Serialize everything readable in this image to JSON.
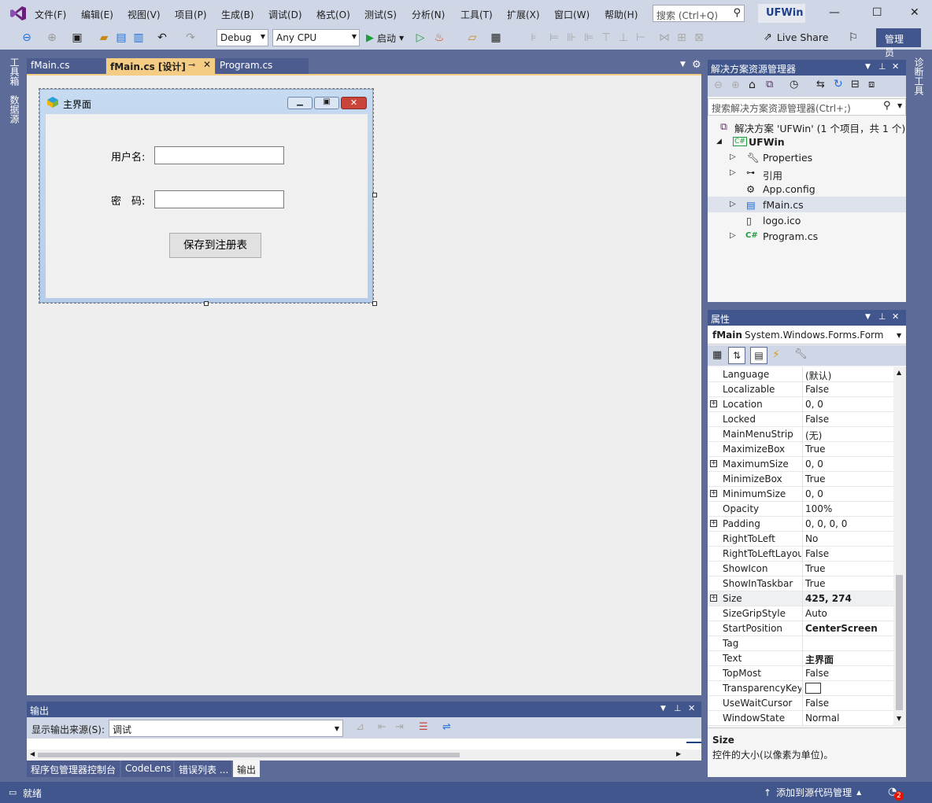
{
  "titlebar": {
    "menu": [
      "文件(F)",
      "编辑(E)",
      "视图(V)",
      "项目(P)",
      "生成(B)",
      "调试(D)",
      "格式(O)",
      "测试(S)",
      "分析(N)",
      "工具(T)",
      "扩展(X)",
      "窗口(W)",
      "帮助(H)"
    ],
    "search_placeholder": "搜索 (Ctrl+Q)",
    "solution_name": "UFWin",
    "minimize": "—",
    "maximize": "☐",
    "close": "✕"
  },
  "toolbar": {
    "config": "Debug",
    "platform": "Any CPU",
    "start_label": "启动",
    "live_share": "Live Share",
    "admin_label": "管理员"
  },
  "left_strip": {
    "toolbox": "工具箱",
    "datasource": "数据源"
  },
  "right_strip": {
    "diagnostics": "诊断工具"
  },
  "doc_tabs": [
    {
      "label": "fMain.cs"
    },
    {
      "label": "fMain.cs [设计]"
    },
    {
      "label": "Program.cs"
    }
  ],
  "form": {
    "title": "主界面",
    "username_label": "用户名:",
    "password_label": "密　码:",
    "save_button": "保存到注册表"
  },
  "solution_explorer": {
    "title": "解决方案资源管理器",
    "search_placeholder": "搜索解决方案资源管理器(Ctrl+;)",
    "items": [
      {
        "label": "解决方案 'UFWin' (1 个项目，共 1 个)"
      },
      {
        "label": "UFWin"
      },
      {
        "label": "Properties"
      },
      {
        "label": "引用"
      },
      {
        "label": "App.config"
      },
      {
        "label": "fMain.cs"
      },
      {
        "label": "logo.ico"
      },
      {
        "label": "Program.cs"
      }
    ]
  },
  "properties": {
    "title": "属性",
    "object_name": "fMain",
    "object_type": "System.Windows.Forms.Form",
    "rows": [
      {
        "name": "Language",
        "value": "(默认)"
      },
      {
        "name": "Localizable",
        "value": "False"
      },
      {
        "name": "Location",
        "value": "0, 0"
      },
      {
        "name": "Locked",
        "value": "False"
      },
      {
        "name": "MainMenuStrip",
        "value": "(无)"
      },
      {
        "name": "MaximizeBox",
        "value": "True"
      },
      {
        "name": "MaximumSize",
        "value": "0, 0"
      },
      {
        "name": "MinimizeBox",
        "value": "True"
      },
      {
        "name": "MinimumSize",
        "value": "0, 0"
      },
      {
        "name": "Opacity",
        "value": "100%"
      },
      {
        "name": "Padding",
        "value": "0, 0, 0, 0"
      },
      {
        "name": "RightToLeft",
        "value": "No"
      },
      {
        "name": "RightToLeftLayout",
        "value": "False"
      },
      {
        "name": "ShowIcon",
        "value": "True"
      },
      {
        "name": "ShowInTaskbar",
        "value": "True"
      },
      {
        "name": "Size",
        "value": "425, 274"
      },
      {
        "name": "SizeGripStyle",
        "value": "Auto"
      },
      {
        "name": "StartPosition",
        "value": "CenterScreen"
      },
      {
        "name": "Tag",
        "value": ""
      },
      {
        "name": "Text",
        "value": "主界面"
      },
      {
        "name": "TopMost",
        "value": "False"
      },
      {
        "name": "TransparencyKey",
        "value": ""
      },
      {
        "name": "UseWaitCursor",
        "value": "False"
      },
      {
        "name": "WindowState",
        "value": "Normal"
      }
    ],
    "desc_title": "Size",
    "desc_text": "控件的大小(以像素为单位)。"
  },
  "output": {
    "title": "输出",
    "source_label": "显示输出来源(S):",
    "source_value": "调试",
    "bottom_tabs": [
      "程序包管理器控制台",
      "CodeLens",
      "错误列表 ...",
      "输出"
    ]
  },
  "statusbar": {
    "status": "就绪",
    "source_control": "添加到源代码管理",
    "notifications": "2"
  }
}
